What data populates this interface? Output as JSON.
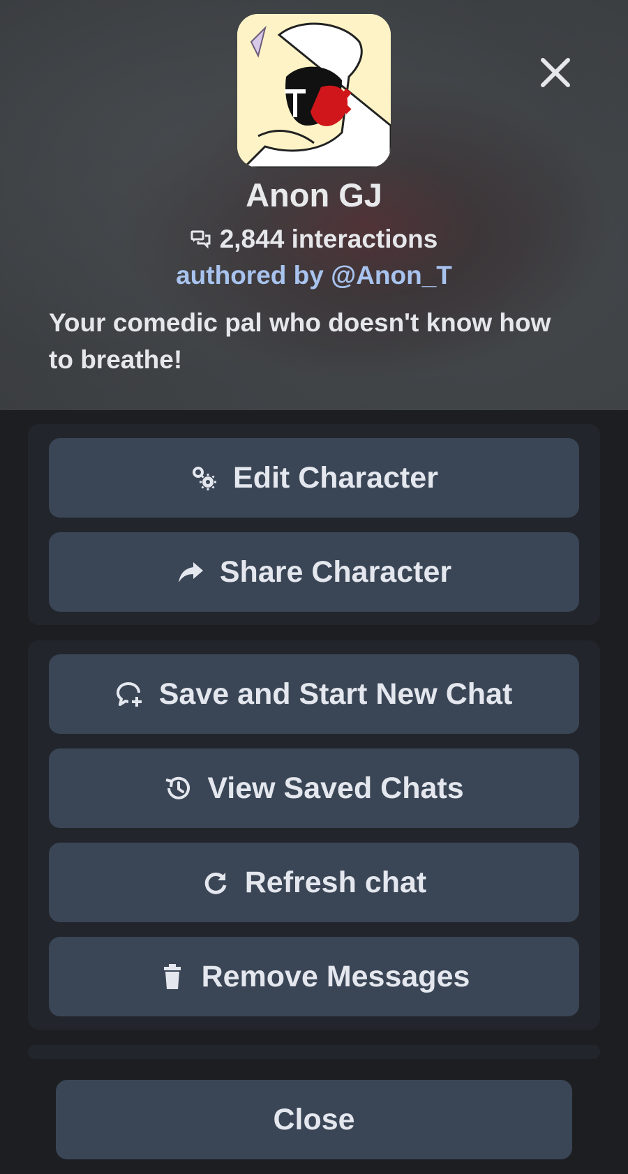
{
  "profile": {
    "name": "Anon GJ",
    "interactions": "2,844 interactions",
    "author": "authored by @Anon_T",
    "description": "Your comedic pal who doesn't know how to breathe!",
    "close_icon": "close-icon"
  },
  "group1": {
    "buttons": [
      {
        "label": "Edit Character",
        "icon": "gears-icon"
      },
      {
        "label": "Share Character",
        "icon": "share-arrow-icon"
      }
    ]
  },
  "group2": {
    "buttons": [
      {
        "label": "Save and Start New Chat",
        "icon": "chat-plus-icon"
      },
      {
        "label": "View Saved Chats",
        "icon": "history-icon"
      },
      {
        "label": "Refresh chat",
        "icon": "refresh-icon"
      },
      {
        "label": "Remove Messages",
        "icon": "trash-icon"
      }
    ]
  },
  "footer": {
    "close_label": "Close"
  },
  "colors": {
    "button_bg": "#3a4656",
    "group_bg": "#22262c",
    "page_bg": "#1c1e22",
    "author_link": "#a8c3ee"
  }
}
